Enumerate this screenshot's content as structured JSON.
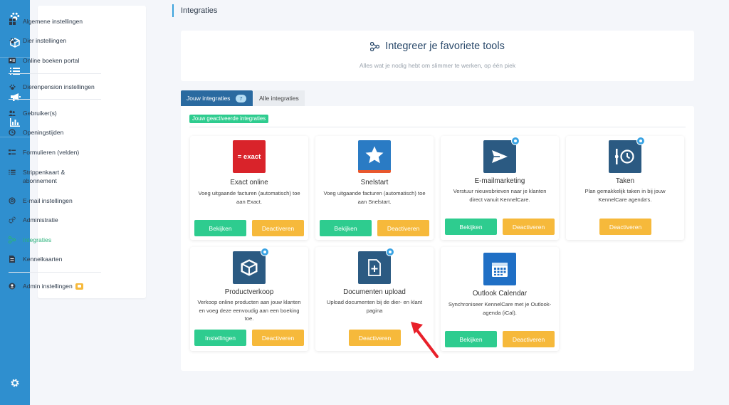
{
  "page": {
    "title": "Integraties"
  },
  "colors": {
    "rail": "#2f8fcf",
    "accent_green": "#2ecc8f",
    "accent_orange": "#f6b93b",
    "tab_active": "#2a6aa0"
  },
  "rail": {
    "icons": [
      "paw-icon",
      "cube-icon",
      "list-icon",
      "megaphone-icon",
      "bar-chart-icon",
      "gear-icon"
    ]
  },
  "nav": {
    "items": [
      {
        "label": "Algemene instellingen",
        "icon": "grid-icon"
      },
      {
        "label": "Dier instellingen",
        "icon": "paw-icon"
      },
      {
        "label": "Online boeken portal",
        "icon": "id-card-icon"
      },
      {
        "label": "Dierenpension instellingen",
        "icon": "paw-icon"
      },
      {
        "label": "Gebruiker(s)",
        "icon": "users-icon"
      },
      {
        "label": "Openingstijden",
        "icon": "clock-icon"
      },
      {
        "label": "Formulieren (velden)",
        "icon": "form-icon"
      },
      {
        "label": "Strippenkaart & abonnement",
        "icon": "list-icon"
      },
      {
        "label": "E-mail instellingen",
        "icon": "at-icon"
      },
      {
        "label": "Administratie",
        "icon": "cogs-icon"
      },
      {
        "label": "Integraties",
        "icon": "nodes-icon"
      },
      {
        "label": "Kennelkaarten",
        "icon": "document-icon"
      },
      {
        "label": "Admin instellingen",
        "icon": "user-circle-icon"
      }
    ]
  },
  "hero": {
    "title": "Integreer je favoriete tools",
    "subtitle": "Alles wat je nodig hebt om slimmer te werken, op één piek"
  },
  "tabs": [
    {
      "label": "Jouw integraties",
      "count": "7"
    },
    {
      "label": "Alle integraties"
    }
  ],
  "section_label": "Jouw geactiveerde integraties",
  "cards": [
    {
      "title": "Exact online",
      "desc": "Voeg uitgaande facturen (automatisch) toe aan Exact.",
      "logo_text": "= exact",
      "primary": "Bekijken",
      "secondary": "Deactiveren"
    },
    {
      "title": "Snelstart",
      "desc": "Voeg uitgaande facturen (automatisch) toe aan Snelstart.",
      "primary": "Bekijken",
      "secondary": "Deactiveren"
    },
    {
      "title": "E-mailmarketing",
      "desc": "Verstuur nieuwsbrieven naar je klanten direct vanuit KennelCare.",
      "primary": "Bekijken",
      "secondary": "Deactiveren"
    },
    {
      "title": "Taken",
      "desc": "Plan gemakkelijk taken in bij jouw KennelCare agenda's.",
      "secondary": "Deactiveren"
    },
    {
      "title": "Productverkoop",
      "desc": "Verkoop online producten aan jouw klanten en voeg deze eenvoudig aan een boeking toe.",
      "primary": "Instellingen",
      "secondary": "Deactiveren"
    },
    {
      "title": "Documenten upload",
      "desc": "Upload documenten bij de dier- en klant pagina",
      "secondary": "Deactiveren"
    },
    {
      "title": "Outlook Calendar",
      "desc": "Synchroniseer KennelCare met je Outlook-agenda (iCal).",
      "primary": "Bekijken",
      "secondary": "Deactiveren"
    }
  ]
}
